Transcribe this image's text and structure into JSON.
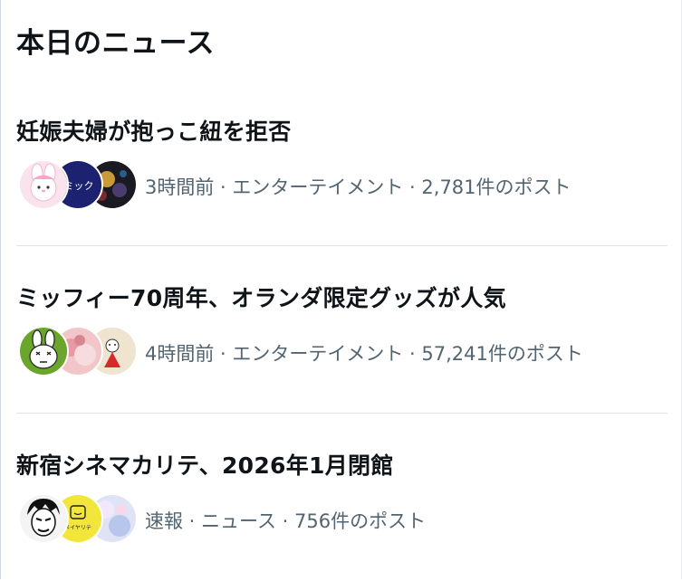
{
  "section": {
    "title": "本日のニュース"
  },
  "items": [
    {
      "headline": "妊娠夫婦が抱っこ紐を拒否",
      "meta": "3時間前 · エンターテイメント · 2,781件のポスト",
      "avatars": [
        "pink-character-avatar",
        "comic-label-avatar",
        "dark-photo-avatar"
      ],
      "avatar_text": "ミック"
    },
    {
      "headline": "ミッフィー70周年、オランダ限定グッズが人気",
      "meta": "4時間前 · エンターテイメント · 57,241件のポスト",
      "avatars": [
        "green-rabbit-avatar",
        "pink-photo-avatar",
        "red-figure-avatar"
      ]
    },
    {
      "headline": "新宿シネマカリテ、2026年1月閉館",
      "meta": "速報 · ニュース · 756件のポスト",
      "avatars": [
        "manga-face-avatar",
        "yellow-logo-avatar",
        "light-photo-avatar"
      ],
      "avatar_text": "メイヤリテ"
    }
  ],
  "colors": {
    "text_primary": "#0f1419",
    "text_secondary": "#536471",
    "divider": "#dfe3e6",
    "background": "#ffffff"
  }
}
